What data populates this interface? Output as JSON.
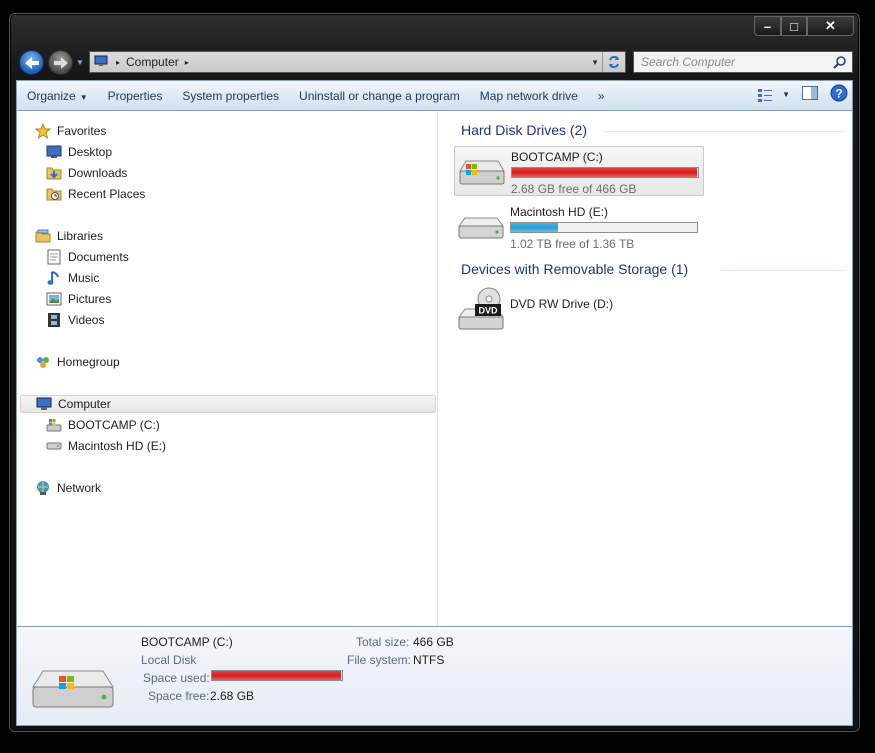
{
  "window": {
    "caption_buttons": {
      "minimize": "–",
      "maximize": "□",
      "close": "✕"
    }
  },
  "address": {
    "root_glyph": "▸",
    "location": "Computer",
    "trail_glyph": "▸"
  },
  "search": {
    "placeholder": "Search Computer"
  },
  "toolbar": {
    "organize": "Organize",
    "organize_caret": "▼",
    "properties": "Properties",
    "system_properties": "System properties",
    "uninstall": "Uninstall or change a program",
    "map_drive": "Map network drive",
    "more": "»",
    "view_caret": "▼"
  },
  "nav": {
    "favorites": "Favorites",
    "desktop": "Desktop",
    "downloads": "Downloads",
    "recent_places": "Recent Places",
    "libraries": "Libraries",
    "documents": "Documents",
    "music": "Music",
    "pictures": "Pictures",
    "videos": "Videos",
    "homegroup": "Homegroup",
    "computer": "Computer",
    "bootcamp": "BOOTCAMP (C:)",
    "macintosh": "Macintosh HD (E:)",
    "network": "Network"
  },
  "groups": {
    "hard_disks": "Hard Disk Drives (2)",
    "removable": "Devices with Removable Storage (1)"
  },
  "drives": {
    "bootcamp": {
      "name": "BOOTCAMP (C:)",
      "free": "2.68 GB free of 466 GB",
      "used_fraction": 0.994,
      "bar_color": "#d81c1c"
    },
    "macintosh": {
      "name": "Macintosh HD (E:)",
      "free": "1.02 TB free of 1.36 TB",
      "used_fraction": 0.25,
      "bar_color": "#26a0da"
    },
    "dvd": {
      "name": "DVD RW Drive (D:)",
      "badge": "DVD"
    }
  },
  "details": {
    "name": "BOOTCAMP (C:)",
    "type": "Local Disk",
    "space_used_label": "Space used:",
    "space_used_fraction": 0.994,
    "space_free_label": "Space free:",
    "space_free_value": "2.68 GB",
    "total_size_label": "Total size:",
    "total_size_value": "466 GB",
    "file_system_label": "File system:",
    "file_system_value": "NTFS"
  }
}
